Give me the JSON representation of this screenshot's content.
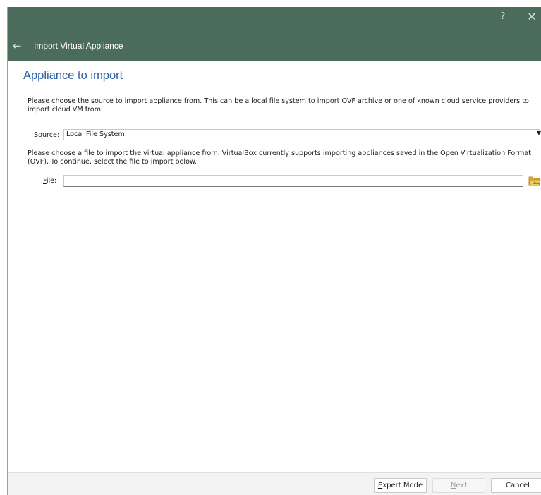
{
  "window": {
    "title": "Import Virtual Appliance",
    "help_glyph": "?",
    "close_glyph": "✕",
    "back_glyph": "←",
    "titlebar_color": "#4b6b5c"
  },
  "page": {
    "heading": "Appliance to import",
    "heading_color": "#2b5ea8",
    "source_description": "Please choose the source to import appliance from. This can be a local file system to import OVF archive or one of known cloud service providers to import cloud VM from.",
    "file_description": "Please choose a file to import the virtual appliance from. VirtualBox currently supports importing appliances saved in the Open Virtualization Format (OVF). To continue, select the file to import below."
  },
  "source": {
    "label_mnemonic": "S",
    "label_rest": "ource:",
    "selected": "Local File System",
    "arrow_glyph": "▼"
  },
  "file": {
    "label_mnemonic": "F",
    "label_rest": "ile:",
    "value": "",
    "button_icon": "folder-open-icon"
  },
  "buttons": {
    "expert_mnemonic": "E",
    "expert_rest": "xpert Mode",
    "next_mnemonic": "N",
    "next_rest": "ext",
    "next_disabled": true,
    "cancel": "Cancel"
  }
}
